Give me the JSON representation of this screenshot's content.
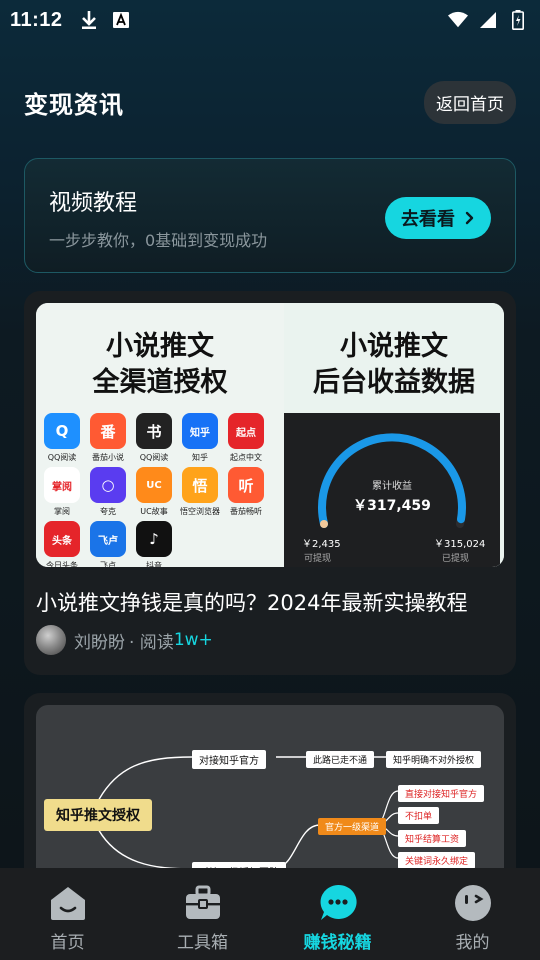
{
  "status": {
    "time": "11:12"
  },
  "header": {
    "title": "变现资讯",
    "back_label": "返回首页"
  },
  "video_card": {
    "title": "视频教程",
    "subtitle": "一步步教你，0基础到变现成功",
    "cta": "去看看"
  },
  "article1": {
    "thumb_left_text": "小说推文\n全渠道授权",
    "thumb_right_text": "小说推文\n后台收益数据",
    "apps": [
      {
        "name": "QQ阅读",
        "color": "#1e90ff",
        "glyph": "Q"
      },
      {
        "name": "番茄小说",
        "color": "#ff5a33",
        "glyph": "番"
      },
      {
        "name": "QQ阅读",
        "color": "#222222",
        "glyph": "书"
      },
      {
        "name": "知乎",
        "color": "#1772f6",
        "glyph": "知乎"
      },
      {
        "name": "起点中文",
        "color": "#e5252a",
        "glyph": "起点"
      },
      {
        "name": "掌阅",
        "color": "#ffffff",
        "glyph": "掌阅"
      },
      {
        "name": "夸克",
        "color": "#5a3cf0",
        "glyph": "○"
      },
      {
        "name": "UC故事",
        "color": "#ff8a1a",
        "glyph": "UC"
      },
      {
        "name": "悟空浏览器",
        "color": "#ffa31a",
        "glyph": "悟"
      },
      {
        "name": "番茄畅听",
        "color": "#ff5a33",
        "glyph": "听"
      },
      {
        "name": "今日头条",
        "color": "#e5252a",
        "glyph": "头条"
      },
      {
        "name": "飞卢",
        "color": "#1a74e8",
        "glyph": "飞卢"
      },
      {
        "name": "抖音",
        "color": "#111111",
        "glyph": "♪"
      }
    ],
    "dashboard": {
      "label": "累计收益",
      "total": "￥317,459",
      "withdrawable": "￥2,435",
      "withdrawable_label": "可提现",
      "withdrawn": "￥315,024",
      "withdrawn_label": "已提现",
      "progress": 0.98
    },
    "title": "小说推文挣钱是真的吗？2024年最新实操教程",
    "author": "刘盼盼",
    "reads_prefix": "· 阅读",
    "reads": "1w+"
  },
  "article2": {
    "root": "知乎推文授权",
    "nodes": [
      "对接知乎官方",
      "此路已走不通",
      "知乎明确不对外授权",
      "官方一级渠道",
      "直接对接知乎官方",
      "不扣单",
      "知乎结算工资",
      "关键词永久绑定",
      "对接二级授权团队"
    ]
  },
  "tabbar": {
    "items": [
      {
        "label": "首页",
        "icon": "home-icon"
      },
      {
        "label": "工具箱",
        "icon": "toolbox-icon"
      },
      {
        "label": "赚钱秘籍",
        "icon": "chat-icon"
      },
      {
        "label": "我的",
        "icon": "profile-icon"
      }
    ],
    "active": 2,
    "accent": "#16d6e0"
  }
}
